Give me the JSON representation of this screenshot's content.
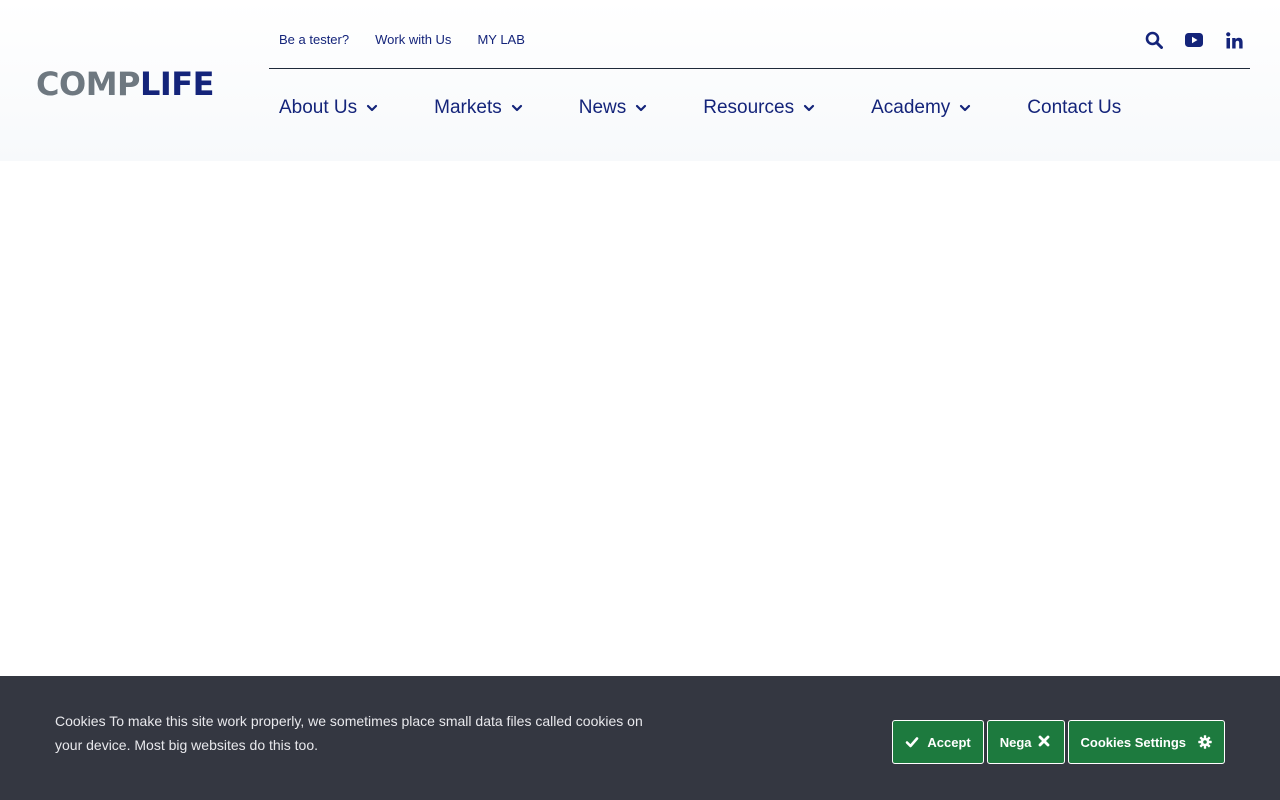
{
  "brand": {
    "logo_part1": "COMP",
    "logo_part2": "LIFE",
    "color_primary": "#14247a",
    "color_gray": "#6e7880"
  },
  "top_links": [
    {
      "label": "Be a tester?"
    },
    {
      "label": "Work with Us"
    },
    {
      "label": "MY LAB"
    }
  ],
  "top_icons": [
    "search-icon",
    "youtube-icon",
    "linkedin-icon"
  ],
  "nav": [
    {
      "label": "About Us",
      "has_dropdown": true
    },
    {
      "label": "Markets",
      "has_dropdown": true
    },
    {
      "label": "News",
      "has_dropdown": true
    },
    {
      "label": "Resources",
      "has_dropdown": true
    },
    {
      "label": "Academy",
      "has_dropdown": true
    },
    {
      "label": "Contact Us",
      "has_dropdown": false
    }
  ],
  "cookie_banner": {
    "text": "Cookies To make this site work properly, we sometimes place small data files called cookies on your device. Most big websites do this too.",
    "accept_label": "Accept",
    "deny_label": "Nega",
    "settings_label": "Cookies Settings",
    "background": "#343741",
    "button_color": "#1d7a3e"
  }
}
